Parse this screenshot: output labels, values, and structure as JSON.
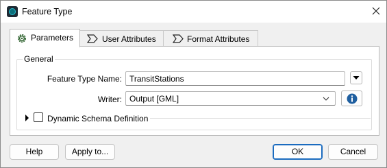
{
  "window": {
    "title": "Feature Type"
  },
  "tabs": [
    {
      "label": "Parameters",
      "icon": "gear-icon",
      "active": true
    },
    {
      "label": "User Attributes",
      "icon": "attribute-tag-icon",
      "active": false
    },
    {
      "label": "Format Attributes",
      "icon": "attribute-tag-icon",
      "active": false
    }
  ],
  "general": {
    "group_label": "General",
    "feature_type_name": {
      "label": "Feature Type Name:",
      "value": "TransitStations"
    },
    "writer": {
      "label": "Writer:",
      "value": "Output [GML]"
    }
  },
  "dynamic_schema": {
    "label": "Dynamic Schema Definition",
    "checked": false,
    "expanded": false
  },
  "buttons": {
    "help": "Help",
    "apply_to": "Apply to...",
    "ok": "OK",
    "cancel": "Cancel"
  },
  "colors": {
    "info_blue": "#1f5fa0",
    "primary_border": "#1a6bbf",
    "app_icon_cyan": "#27c3d6"
  }
}
